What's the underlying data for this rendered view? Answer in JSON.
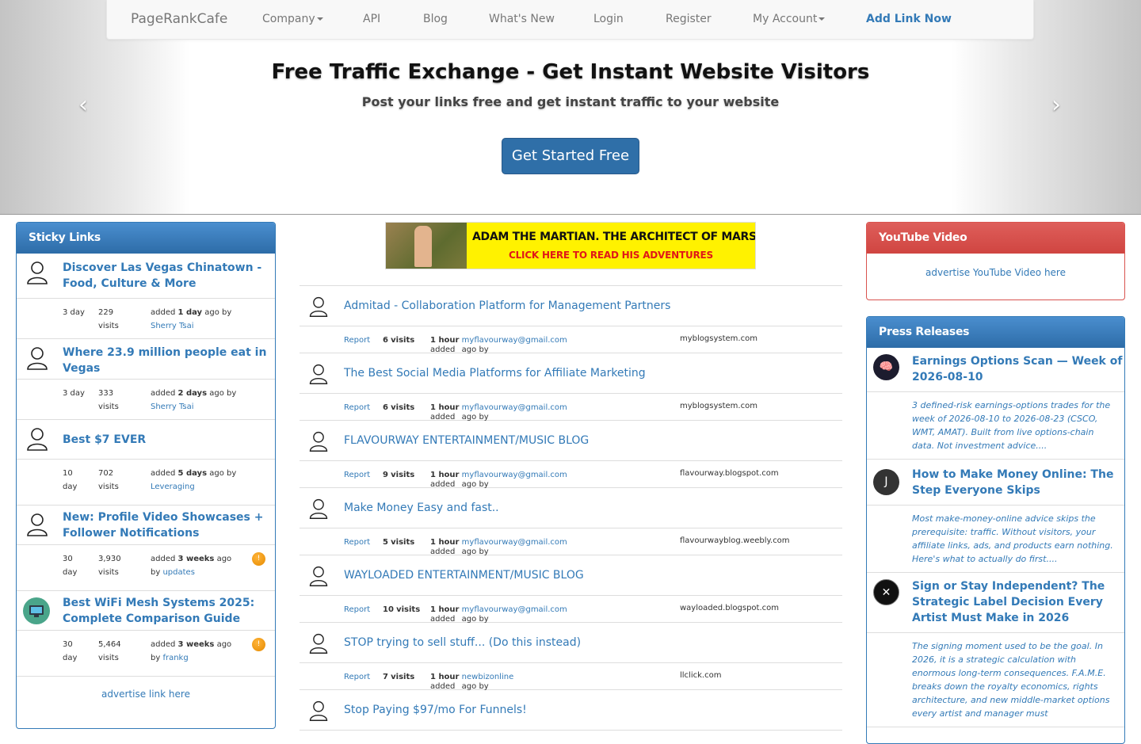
{
  "nav": {
    "brand": "PageRankCafe",
    "company": "Company",
    "api": "API",
    "blog": "Blog",
    "whats_new": "What's New",
    "login": "Login",
    "register": "Register",
    "my_account": "My Account",
    "add_link": "Add Link Now"
  },
  "hero": {
    "title": "Free Traffic Exchange - Get Instant Website Visitors",
    "subtitle": "Post your links free and get instant traffic to your website",
    "button": "Get Started Free",
    "prev": "‹",
    "next": "›"
  },
  "sticky": {
    "header": "Sticky Links",
    "items": [
      {
        "title": "Discover Las Vegas Chinatown - Food, Culture & More",
        "age": "3 day",
        "visits": "229",
        "visits_label": "visits",
        "added_pre": "added",
        "added_when": "1 day",
        "added_post": "ago by",
        "by": "Sherry Tsai"
      },
      {
        "title": "Where 23.9 million people eat in Vegas",
        "age": "3 day",
        "visits": "333",
        "visits_label": "visits",
        "added_pre": "added",
        "added_when": "2 days",
        "added_post": "ago by",
        "by": "Sherry Tsai"
      },
      {
        "title": "Best $7 EVER",
        "age_num": "10",
        "age_unit": "day",
        "visits": "702",
        "visits_label": "visits",
        "added_pre": "added",
        "added_when": "5 days",
        "added_post": "ago by",
        "by": "Leveraging"
      },
      {
        "title": "New: Profile Video Showcases + Follower Notifications",
        "age_num": "30",
        "age_unit": "day",
        "visits": "3,930",
        "visits_label": "visits",
        "added_pre": "added",
        "added_when": "3 weeks",
        "added_post": "ago",
        "by_pre": "by",
        "by": "updates"
      },
      {
        "title": "Best WiFi Mesh Systems 2025: Complete Comparison Guide",
        "age_num": "30",
        "age_unit": "day",
        "visits": "5,464",
        "visits_label": "visits",
        "added_pre": "added",
        "added_when": "3 weeks",
        "added_post": "ago",
        "by_pre": "by",
        "by": "frankg"
      }
    ],
    "advertise": "advertise link here"
  },
  "banner": {
    "line1": "ADAM THE MARTIAN. THE ARCHITECT OF MARS.",
    "line2": "CLICK HERE TO READ HIS ADVENTURES"
  },
  "feed": {
    "report_label": "Report",
    "visits_label": "visits",
    "added_pre": "added",
    "ago_by": "ago by",
    "items": [
      {
        "title": "Admitad - Collaboration Platform for Management Partners",
        "visits": "6",
        "when": "1 hour",
        "by": "myflavourway@gmail.com",
        "domain": "myblogsystem.com"
      },
      {
        "title": "The Best Social Media Platforms for Affiliate Marketing",
        "visits": "6",
        "when": "1 hour",
        "by": "myflavourway@gmail.com",
        "domain": "myblogsystem.com"
      },
      {
        "title": "FLAVOURWAY ENTERTAINMENT/MUSIC BLOG",
        "visits": "9",
        "when": "1 hour",
        "by": "myflavourway@gmail.com",
        "domain": "flavourway.blogspot.com"
      },
      {
        "title": "Make Money Easy and fast..",
        "visits": "5",
        "when": "1 hour",
        "by": "myflavourway@gmail.com",
        "domain": "flavourwayblog.weebly.com"
      },
      {
        "title": "WAYLOADED ENTERTAINMENT/MUSIC BLOG",
        "visits": "10",
        "when": "1 hour",
        "by": "myflavourway@gmail.com",
        "domain": "wayloaded.blogspot.com"
      },
      {
        "title": "STOP trying to sell stuff... (Do this instead)",
        "visits": "7",
        "when": "1 hour",
        "by": "newbizonline",
        "domain": "llclick.com"
      },
      {
        "title": "Stop Paying $97/mo For Funnels!"
      }
    ]
  },
  "youtube": {
    "header": "YouTube Video",
    "advertise": "advertise YouTube Video here"
  },
  "press": {
    "header": "Press Releases",
    "items": [
      {
        "title": "Earnings Options Scan — Week of 2026-08-10",
        "avatar": "🧠",
        "desc": "3 defined-risk earnings-options trades for the week of 2026-08-10 to 2026-08-23 (CSCO, WMT, AMAT). Built from live options-chain data. Not investment advice...."
      },
      {
        "title": "How to Make Money Online: The Step Everyone Skips",
        "avatar": "J",
        "desc": "Most make-money-online advice skips the prerequisite: traffic. Without visitors, your affiliate links, ads, and products earn nothing. Here's what to actually do first...."
      },
      {
        "title": "Sign or Stay Independent? The Strategic Label Decision Every Artist Must Make in 2026",
        "avatar": "✕",
        "desc": "The signing moment used to be the goal. In 2026, it is a strategic calculation with enormous long-term consequences. F.A.M.E. breaks down the royalty economics, rights architecture, and new middle-market options every artist and manager must"
      }
    ]
  },
  "colors": {
    "link": "#337ab7",
    "panel_primary": "#337ab7",
    "panel_danger": "#d9534f"
  }
}
